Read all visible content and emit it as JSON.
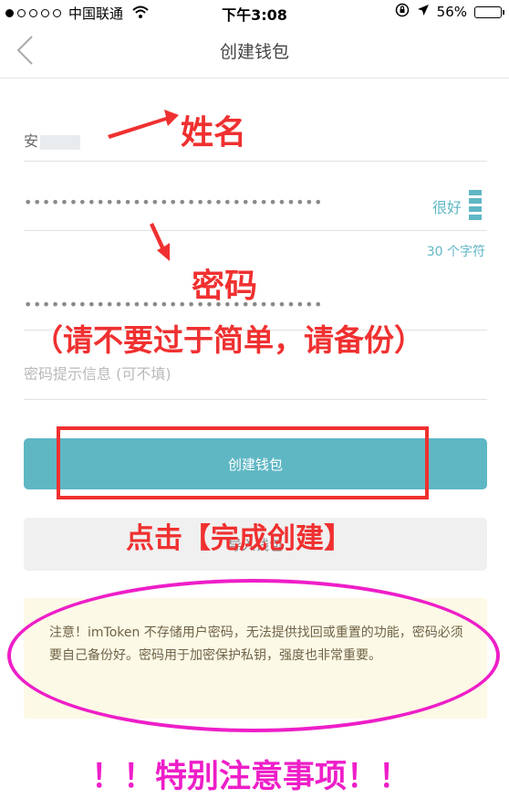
{
  "status_bar": {
    "carrier": "中国联通",
    "time": "下午3:08",
    "battery": "56%",
    "battery_level": 0.56,
    "signal_dots_filled": 1,
    "signal_dots_total": 5,
    "icons": [
      "wifi-icon",
      "rotation-lock-icon",
      "location-arrow-icon",
      "battery-icon"
    ]
  },
  "nav": {
    "title": "创建钱包",
    "back_icon": "chevron-left-icon"
  },
  "form": {
    "name_value": "安",
    "password_mask": "•••••••••••••••••••••••••••••••••",
    "strength_label": "很好",
    "char_count": "30 个字符",
    "repeat_password_mask": "•••••••••••••••••••••••••••••••••",
    "hint_placeholder": "密码提示信息 (可不填)"
  },
  "buttons": {
    "create": "创建钱包",
    "import": "导入钱包"
  },
  "notice": {
    "text": "注意！imToken 不存储用户密码，无法提供找回或重置的功能，密码必须要自己备份好。密码用于加密保护私钥，强度也非常重要。"
  },
  "annotations": {
    "name": "姓名",
    "password": "密码",
    "password_note": "（请不要过于简单，请备份）",
    "click": "点击【完成创建】",
    "special": "！！特别注意事项！！"
  },
  "colors": {
    "accent": "#5fb7c4",
    "annotation_red": "#f03030",
    "annotation_magenta": "#ee1ec8",
    "notice_bg": "#fcf9e6"
  }
}
